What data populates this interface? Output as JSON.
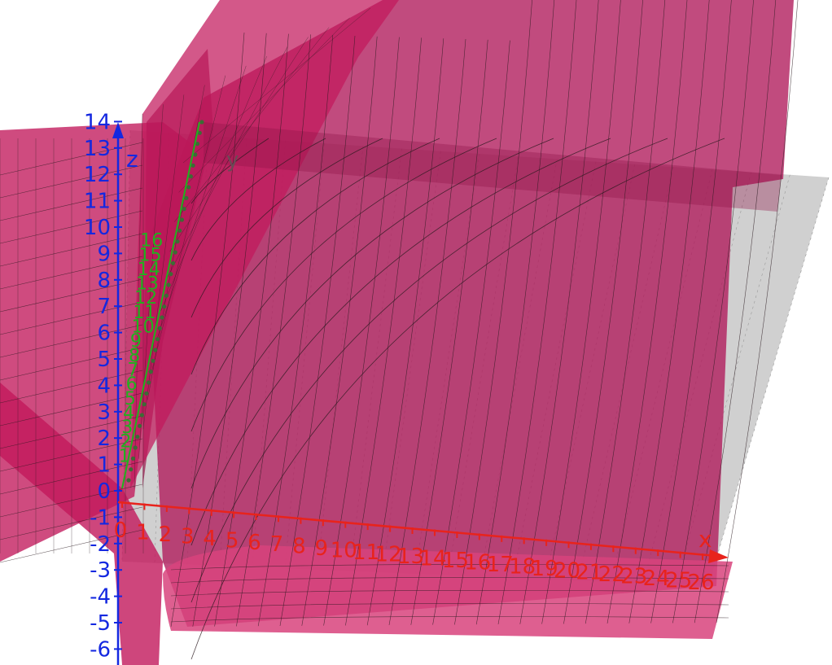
{
  "colors": {
    "surface": "#c2185b",
    "surface_dark": "#a0174f",
    "surface_light": "#d8437c",
    "plane": "#c8c8c8",
    "mesh": "#2a1a1f",
    "x_axis": "#e8231c",
    "y_axis": "#20b21e",
    "z_axis": "#1428e0"
  },
  "axes": {
    "x": {
      "label": "x",
      "ticks": [
        "0",
        "1",
        "2",
        "3",
        "4",
        "5",
        "6",
        "7",
        "8",
        "9",
        "10",
        "11",
        "12",
        "13",
        "14",
        "15",
        "16",
        "17",
        "18",
        "19",
        "20",
        "21",
        "22",
        "23",
        "24",
        "25",
        "26"
      ]
    },
    "y": {
      "label": "y",
      "ticks": [
        "1",
        "2",
        "3",
        "4",
        "5",
        "6",
        "7",
        "8",
        "9",
        "10",
        "11",
        "12",
        "13",
        "14",
        "15",
        "16"
      ]
    },
    "z": {
      "label": "z",
      "ticks": [
        "-6",
        "-5",
        "-4",
        "-3",
        "-2",
        "-1",
        "0",
        "1",
        "2",
        "3",
        "4",
        "5",
        "6",
        "7",
        "8",
        "9",
        "10",
        "11",
        "12",
        "13",
        "14"
      ]
    }
  }
}
